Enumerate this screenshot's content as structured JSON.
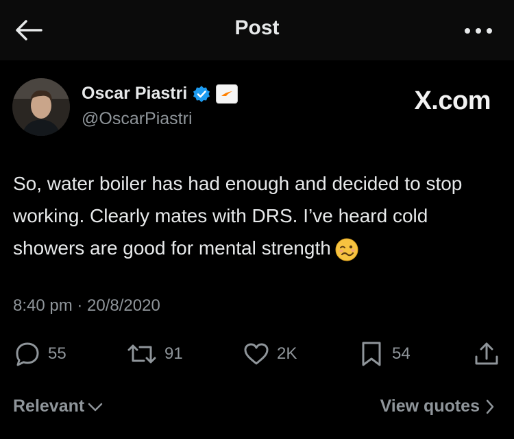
{
  "header": {
    "title": "Post",
    "back_icon": "arrow-left-icon",
    "more_icon": "ellipsis-icon"
  },
  "author": {
    "name": "Oscar Piastri",
    "handle": "@OscarPiastri",
    "verified_icon": "verified-badge-icon",
    "affiliate_icon": "mclaren-affiliate-badge"
  },
  "watermark": "X.com",
  "post": {
    "text": "So, water boiler has had enough and decided to stop working. Clearly mates with DRS. I’ve heard cold showers are good for mental strength",
    "emoji": "woozy-face-emoji",
    "timestamp": "8:40 pm · 20/8/2020"
  },
  "actions": {
    "replies": "55",
    "reposts": "91",
    "likes": "2K",
    "bookmarks": "54"
  },
  "footer": {
    "sort_label": "Relevant",
    "view_quotes_label": "View quotes"
  },
  "colors": {
    "background": "#000000",
    "header": "#0b0b0b",
    "text": "#e7e9ea",
    "muted": "#8f959a",
    "verified": "#1d9bf0",
    "mclaren_orange": "#ff8000"
  }
}
